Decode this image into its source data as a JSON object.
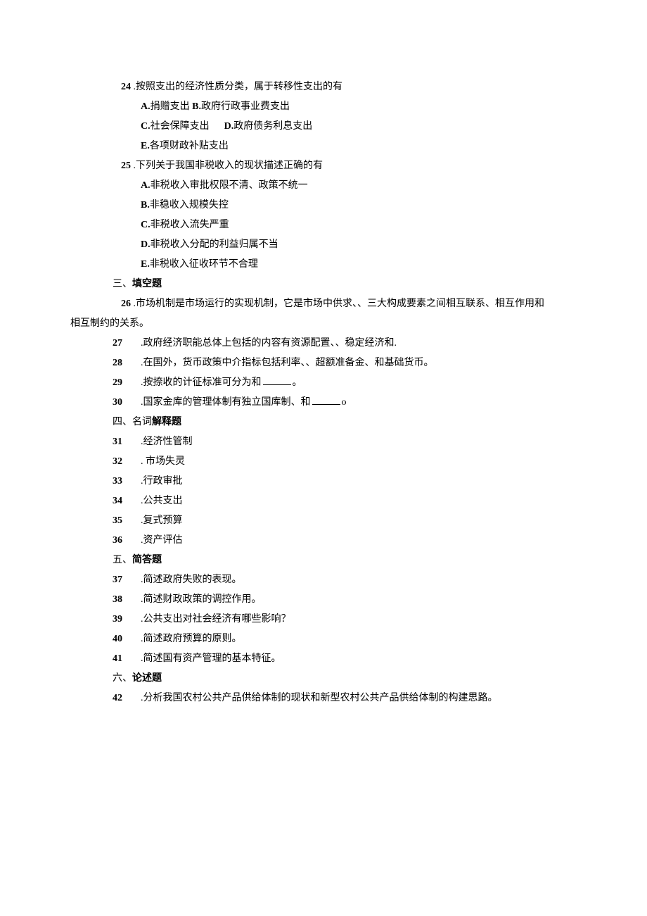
{
  "q24": {
    "num": "24",
    "text": " .按照支出的经济性质分类，属于转移性支出的有",
    "optA_label": "A.",
    "optA_text": "捐赠支出 ",
    "optB_label": "B.",
    "optB_text": "政府行政事业费支出",
    "optC_label": "C.",
    "optC_text": "社会保障支出",
    "optD_label": "D.",
    "optD_text": "政府债务利息支出",
    "optE_label": "E.",
    "optE_text": "各项财政补贴支出"
  },
  "q25": {
    "num": "25",
    "text": " .下列关于我国非税收入的现状描述正确的有",
    "optA_label": "A.",
    "optA_text": "非税收入审批权限不清、政策不统一",
    "optB_label": "B.",
    "optB_text": "非稳收入规模失控",
    "optC_label": "C.",
    "optC_text": "非税收入流失严重",
    "optD_label": "D.",
    "optD_text": "非税收入分配的利益归属不当",
    "optE_label": "E.",
    "optE_text": "非税收入征收环节不合理"
  },
  "section3": {
    "prefix": "三、",
    "bold": "填空题"
  },
  "q26": {
    "num": "26",
    "text": " .市场机制是市场运行的实现机制，它是市场中供求、、三大构成要素之间相互联系、相互作用和",
    "cont": "相互制约的关系。"
  },
  "q27": {
    "num": "27",
    "text": ".政府经济职能总体上包括的内容有资源配置、、稳定经济和."
  },
  "q28": {
    "num": "28",
    "text": ".在国外，货币政策中介指标包括利率、、超额准备金、和基础货币。"
  },
  "q29": {
    "num": "29",
    "text_a": ".按捺收的计征标准可分为和",
    "text_b": "。"
  },
  "q30": {
    "num": "30",
    "text_a": ".国家金库的管理体制有独立国库制、和",
    "text_b": "o"
  },
  "section4": {
    "prefix": "四、名词",
    "bold": "解释题"
  },
  "q31": {
    "num": "31",
    "text": ".经济性管制"
  },
  "q32": {
    "num": "32",
    "text": ". 市场失灵"
  },
  "q33": {
    "num": "33",
    "text": ".行政审批"
  },
  "q34": {
    "num": "34",
    "text": ".公共支出"
  },
  "q35": {
    "num": "35",
    "text": ".复式预算"
  },
  "q36": {
    "num": "36",
    "text": ".资产评估"
  },
  "section5": {
    "prefix": "五、",
    "bold": "简答题"
  },
  "q37": {
    "num": "37",
    "text": ".简述政府失败的表现。"
  },
  "q38": {
    "num": "38",
    "text": ".简述财政政策的调控作用。"
  },
  "q39": {
    "num": "39",
    "text": ".公共支出对社会经济有哪些影响？"
  },
  "q40": {
    "num": "40",
    "text": ".简述政府预算的原则。"
  },
  "q41": {
    "num": "41",
    "text": ".简述国有资产管理的基本特征。"
  },
  "section6": {
    "prefix": "六、",
    "bold": "论述题"
  },
  "q42": {
    "num": "42",
    "text": ".分析我国农村公共产品供给体制的现状和新型农村公共产品供给体制的构建思路。"
  }
}
